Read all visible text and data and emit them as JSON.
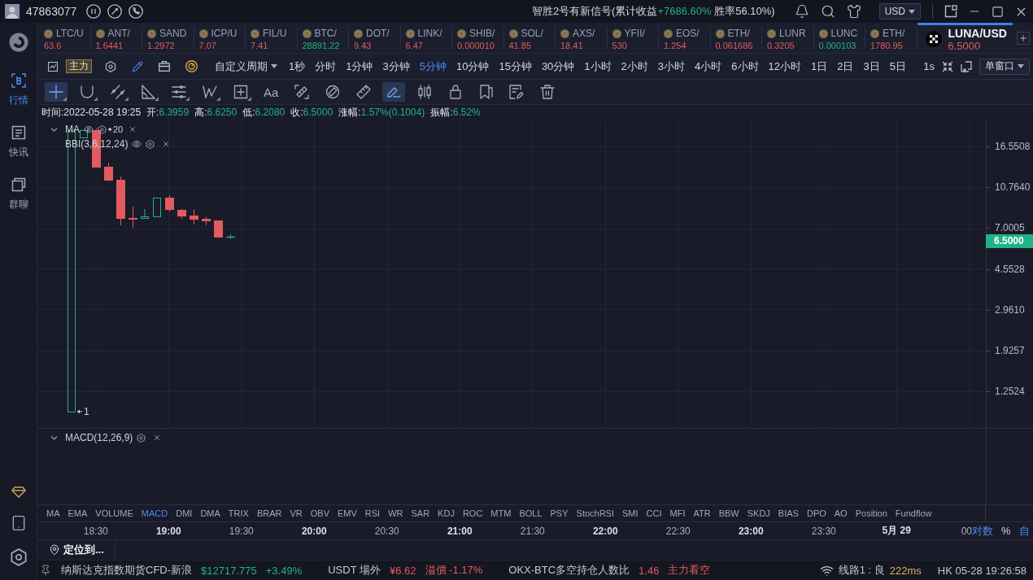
{
  "top_bar": {
    "account_id": "47863077",
    "signal_notice": {
      "prefix": "智胜2号有新信号(累计收益",
      "gain": "+7686.60%",
      "suffix": " 胜率56.10%)"
    },
    "currency": "USD"
  },
  "sidebar": {
    "items": [
      {
        "kind": "market",
        "label": "行情",
        "selected": true
      },
      {
        "kind": "news",
        "label": "快讯",
        "selected": false
      },
      {
        "kind": "chat",
        "label": "群聊",
        "selected": false
      }
    ]
  },
  "tickers": [
    {
      "symbol": "LTC/U",
      "price": "63.6",
      "rising": false
    },
    {
      "symbol": "ANT/",
      "price": "1.6441",
      "rising": false
    },
    {
      "symbol": "SAND",
      "price": "1.2972",
      "rising": false
    },
    {
      "symbol": "ICP/U",
      "price": "7.07",
      "rising": false
    },
    {
      "symbol": "FIL/U",
      "price": "7.41",
      "rising": false
    },
    {
      "symbol": "BTC/",
      "price": "28891.22",
      "rising": true
    },
    {
      "symbol": "DOT/",
      "price": "9.43",
      "rising": false
    },
    {
      "symbol": "LINK/",
      "price": "6.47",
      "rising": false
    },
    {
      "symbol": "SHIB/",
      "price": "0.000010",
      "rising": false
    },
    {
      "symbol": "SOL/",
      "price": "41.85",
      "rising": false
    },
    {
      "symbol": "AXS/",
      "price": "18.41",
      "rising": false
    },
    {
      "symbol": "YFII/",
      "price": "530",
      "rising": false
    },
    {
      "symbol": "EOS/",
      "price": "1.254",
      "rising": false
    },
    {
      "symbol": "ETH/",
      "price": "0.061686",
      "rising": false
    },
    {
      "symbol": "LUNR",
      "price": "0.3205",
      "rising": false
    },
    {
      "symbol": "LUNC",
      "price": "0.000103",
      "rising": true
    },
    {
      "symbol": "ETH/",
      "price": "1780.95",
      "rising": false
    }
  ],
  "active_ticker": {
    "symbol": "LUNA/USD",
    "price": "6.5000",
    "rising": false
  },
  "toolbar": {
    "main_force": {
      "label": "主力",
      "on": true
    },
    "custom_period": "自定义周期",
    "periods": [
      {
        "label": "1秒",
        "selected": false
      },
      {
        "label": "分时",
        "selected": false
      },
      {
        "label": "1分钟",
        "selected": false
      },
      {
        "label": "3分钟",
        "selected": false
      },
      {
        "label": "5分钟",
        "selected": true
      },
      {
        "label": "10分钟",
        "selected": false
      },
      {
        "label": "15分钟",
        "selected": false
      },
      {
        "label": "30分钟",
        "selected": false
      },
      {
        "label": "1小时",
        "selected": false
      },
      {
        "label": "2小时",
        "selected": false
      },
      {
        "label": "3小时",
        "selected": false
      },
      {
        "label": "4小时",
        "selected": false
      },
      {
        "label": "6小时",
        "selected": false
      },
      {
        "label": "12小时",
        "selected": false
      },
      {
        "label": "1日",
        "selected": false
      },
      {
        "label": "2日",
        "selected": false
      },
      {
        "label": "3日",
        "selected": false
      },
      {
        "label": "5日",
        "selected": false
      }
    ],
    "refresh": "1s",
    "window_mode": "单窗口"
  },
  "drawing_tools": [
    {
      "kind": "crosshair",
      "menu": true,
      "selected": true
    },
    {
      "kind": "magnet",
      "menu": true,
      "selected": false
    },
    {
      "kind": "parallel",
      "menu": true,
      "selected": false
    },
    {
      "kind": "angle",
      "menu": true,
      "selected": false
    },
    {
      "kind": "levels",
      "menu": true,
      "selected": false
    },
    {
      "kind": "wave",
      "menu": true,
      "selected": false
    },
    {
      "kind": "frame",
      "menu": true,
      "selected": false
    },
    {
      "kind": "text",
      "label": "Aa",
      "menu": false,
      "selected": false
    },
    {
      "kind": "measure",
      "menu": false,
      "selected": false
    },
    {
      "kind": "circle_ruler",
      "menu": false,
      "selected": false
    },
    {
      "kind": "ruler",
      "menu": false,
      "selected": false
    },
    {
      "kind": "brush",
      "menu": false,
      "selected": true
    },
    {
      "kind": "candles",
      "menu": false,
      "selected": false
    },
    {
      "kind": "lock",
      "menu": false,
      "selected": false
    },
    {
      "kind": "bookmark",
      "menu": false,
      "selected": false
    },
    {
      "kind": "note",
      "menu": false,
      "selected": false
    },
    {
      "kind": "trash",
      "menu": false,
      "selected": false
    }
  ],
  "ohlc": {
    "time": "时间:2022-05-28 19:25",
    "fields": [
      {
        "label": "开:",
        "value": "6.3959"
      },
      {
        "label": "高:",
        "value": "6.6250"
      },
      {
        "label": "低:",
        "value": "6.2080"
      },
      {
        "label": "收:",
        "value": "6.5000"
      },
      {
        "label": "涨幅:",
        "value": "1.57%(0.1004)"
      },
      {
        "label": "振幅:",
        "value": "6.52%"
      }
    ]
  },
  "price_chart": {
    "expanded": true,
    "overlays": [
      "MA",
      "BBI(3,6,12,24)"
    ],
    "high_marker": "20",
    "low_marker": "1",
    "price_axis": [
      "16.5508",
      "10.7640",
      "7.0005",
      "4.5528",
      "2.9610",
      "1.9257",
      "1.2524"
    ],
    "last_price": {
      "value": "6.5000",
      "rising": true
    }
  },
  "macd_pane": {
    "label": "MACD(12,26,9)",
    "expanded": true
  },
  "indicator_tabs": [
    {
      "label": "MA",
      "selected": false
    },
    {
      "label": "EMA",
      "selected": false
    },
    {
      "label": "VOLUME",
      "selected": false
    },
    {
      "label": "MACD",
      "selected": true
    },
    {
      "label": "DMI",
      "selected": false
    },
    {
      "label": "DMA",
      "selected": false
    },
    {
      "label": "TRIX",
      "selected": false
    },
    {
      "label": "BRAR",
      "selected": false
    },
    {
      "label": "VR",
      "selected": false
    },
    {
      "label": "OBV",
      "selected": false
    },
    {
      "label": "EMV",
      "selected": false
    },
    {
      "label": "RSI",
      "selected": false
    },
    {
      "label": "WR",
      "selected": false
    },
    {
      "label": "SAR",
      "selected": false
    },
    {
      "label": "KDJ",
      "selected": false
    },
    {
      "label": "ROC",
      "selected": false
    },
    {
      "label": "MTM",
      "selected": false
    },
    {
      "label": "BOLL",
      "selected": false
    },
    {
      "label": "PSY",
      "selected": false
    },
    {
      "label": "StochRSI",
      "selected": false
    },
    {
      "label": "SMI",
      "selected": false
    },
    {
      "label": "CCI",
      "selected": false
    },
    {
      "label": "MFI",
      "selected": false
    },
    {
      "label": "ATR",
      "selected": false
    },
    {
      "label": "BBW",
      "selected": false
    },
    {
      "label": "SKDJ",
      "selected": false
    },
    {
      "label": "BIAS",
      "selected": false
    },
    {
      "label": "DPO",
      "selected": false
    },
    {
      "label": "AO",
      "selected": false
    },
    {
      "label": "Position",
      "selected": false
    },
    {
      "label": "Fundflow",
      "selected": false
    }
  ],
  "time_axis": {
    "labels": [
      {
        "text": "18:30",
        "major": false
      },
      {
        "text": "19:00",
        "major": true
      },
      {
        "text": "19:30",
        "major": false
      },
      {
        "text": "20:00",
        "major": true
      },
      {
        "text": "20:30",
        "major": false
      },
      {
        "text": "21:00",
        "major": true
      },
      {
        "text": "21:30",
        "major": false
      },
      {
        "text": "22:00",
        "major": true
      },
      {
        "text": "22:30",
        "major": false
      },
      {
        "text": "23:00",
        "major": true
      },
      {
        "text": "23:30",
        "major": false
      },
      {
        "text": "5月 29",
        "major": true
      },
      {
        "text": "00",
        "major": false
      }
    ],
    "scale_options": [
      {
        "label": "对数",
        "selected": true
      },
      {
        "label": "%",
        "selected": false
      },
      {
        "label": "自",
        "selected": true
      }
    ]
  },
  "locate_button": "定位到...",
  "status_bar": {
    "groups": [
      {
        "name": "纳斯达克指数期货CFD-新浪",
        "values": [
          {
            "text": "$12717.775",
            "positive": true
          },
          {
            "text": "+3.49%",
            "positive": true
          }
        ]
      },
      {
        "name": "USDT 場外",
        "values": [
          {
            "text": "¥6.62",
            "positive": false
          },
          {
            "text": "溢價 -1.17%",
            "positive": false
          }
        ]
      },
      {
        "name": "OKX-BTC多空持仓人数比",
        "values": [
          {
            "text": "1.46",
            "positive": false
          },
          {
            "text": "主力看空",
            "positive": false
          }
        ]
      }
    ],
    "connection": {
      "label": "线路1 : 良",
      "latency": "222ms"
    },
    "clock": "HK 05-28 19:26:58"
  }
}
